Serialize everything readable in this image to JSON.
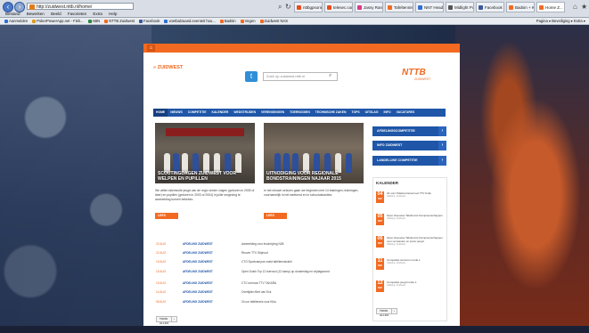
{
  "browser": {
    "url": "http://zuidwest.nttb.nl/home/",
    "tabs": [
      {
        "label": "nttbgpsorien...",
        "color": "#e54c1e"
      },
      {
        "label": "telesec.com",
        "color": "#e54c1e"
      },
      {
        "label": "Jassy Rank...",
        "color": "#d93a8a"
      },
      {
        "label": "Tafeltennis...",
        "color": "#f26a21"
      },
      {
        "label": "NNT Head...",
        "color": "#2f6fd1"
      },
      {
        "label": "Midlight Po...",
        "color": "#555555"
      },
      {
        "label": "Facebook",
        "color": "#3b5998"
      },
      {
        "label": "Badsin + Ka...",
        "color": "#f26a21"
      },
      {
        "label": "Home Z...",
        "color": "#f26a21"
      }
    ],
    "menu": [
      "Bestand",
      "Bewerken",
      "Beeld",
      "Favorieten",
      "Extra",
      "Help"
    ],
    "favorites": [
      {
        "label": "Aanmelden",
        "color": "#2f6fd1"
      },
      {
        "label": "PokerPowerApp.net - Fish...",
        "color": "#e09a1e"
      },
      {
        "label": "ABN",
        "color": "#2b8a3e"
      },
      {
        "label": "NTTB Zuidwest",
        "color": "#f26a21"
      },
      {
        "label": "Facebook",
        "color": "#3b5998"
      },
      {
        "label": "voetbalzaand.eventeit hou...",
        "color": "#2f6fd1"
      },
      {
        "label": "Badsin",
        "color": "#f26a21"
      },
      {
        "label": "Vegen",
        "color": "#f26a21"
      },
      {
        "label": "Zuidwest NAS",
        "color": "#f26a21"
      }
    ],
    "toolbar_right": "Pagina ▾ Beveiliging ▾ Extra ▾"
  },
  "header": {
    "region": "» ZUIDWEST",
    "search_placeholder": "Zoek op zuidwest.nttb.nl",
    "logo_main": "NTTB",
    "logo_sub": "ZUIDWEST"
  },
  "nav": [
    "HOME",
    "NIEUWS",
    "COMPETITIE",
    "KALENDER",
    "WEDSTRIJDEN",
    "VERENIGINGEN",
    "TOERNOOIEN",
    "TECHNISCHE ZAKEN",
    "TOPS",
    "UITSLAG",
    "INFO",
    "VACATURES"
  ],
  "news": [
    {
      "caption": "SCOUTINGDAGEN ZUIDWEST VOOR WELPEN EN PUPILLEN",
      "text": "We willen talentvolle jeugd van de regio verder volgen (geboren in 2005 of later) en pupillen (geboren in 2003 of 2004) in jullie omgeving te aanmelding komen bekeken.",
      "button": "LEES VERDER"
    },
    {
      "caption": "UITNODIGING VOOR REGIONALE BONDSTRAININGEN NAJAAR 2015",
      "text": "In het nieuwe seizoen gaan we beginnen met 14 trainingen; trainingen, voornamelijk in het weekend en in schoolvakanties.",
      "button": "LEES VERDER"
    }
  ],
  "sidebar_buttons": [
    "AFDELINGSCOMPETITIE",
    "INFO ZUIDWEST",
    "LANDELIJKE COMPETITIE"
  ],
  "kalender": {
    "title": "KALENDER",
    "items": [
      {
        "day": "04",
        "month": "SEP",
        "title": "24 uurs Tafeltennistoernooi TTV Kulle",
        "sub": "Afdeling: Zuidwest"
      },
      {
        "day": "05",
        "month": "SEP",
        "title": "Open Zeeuwse Tafeltennis Kampioenschappen",
        "sub": "Afdeling: Zuidwest"
      },
      {
        "day": "06",
        "month": "SEP",
        "title": "Open Zeeuwse Tafeltennis Kampioenschappen voor recreanten en junior jeugd",
        "sub": "Afdeling: Zuidwest"
      },
      {
        "day": "11",
        "month": "SEP",
        "title": "Competitie senioren ronde 1",
        "sub": "Afdeling: Zuidwest"
      },
      {
        "day": "12",
        "month": "SEP",
        "title": "Competitie jeugd ronde 1",
        "sub": "Afdeling: Zuidwest"
      }
    ],
    "button": "TOON ALLES"
  },
  "results": {
    "rows": [
      {
        "date": "22 AUG",
        "cat": "AFDELING ZUIDWEST",
        "title": "Aanmelding voor inschrijving NJB"
      },
      {
        "date": "22 AUG",
        "cat": "AFDELING ZUIDWEST",
        "title": "Reuver TTV Stiphout"
      },
      {
        "date": "15 AUG",
        "cat": "AFDELING ZUIDWEST",
        "title": "CTO Sportcampus zoekt tafeltennisclub!"
      },
      {
        "date": "15 AUG",
        "cat": "AFDELING ZUIDWEST",
        "title": "Open Dutch Tcp 12 toernooi (12 kamp) op donderdag en vrijdagavond"
      },
      {
        "date": "15 AUG",
        "cat": "AFDELING ZUIDWEST",
        "title": "CTC toernooi TTV TAKARA"
      },
      {
        "date": "14 AUG",
        "cat": "AFDELING ZUIDWEST",
        "title": "Overlijden Bert van Eck"
      },
      {
        "date": "08 AUG",
        "cat": "AFDELING ZUIDWEST",
        "title": "24 uur tafeltennis voor Kika"
      }
    ],
    "button": "TOON ALLES"
  }
}
